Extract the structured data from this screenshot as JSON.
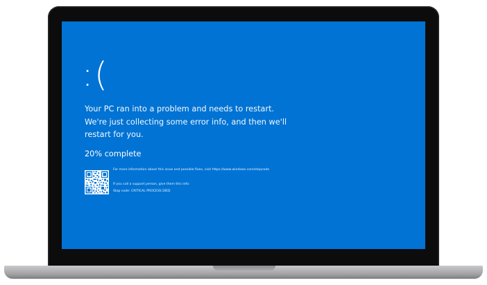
{
  "bsod": {
    "sad_face": ":(",
    "message": "Your PC ran into a problem and needs to restart. We're just collecting some error info, and then we'll restart for you.",
    "progress_text": "20% complete",
    "more_info": "For more information about this issue and possible fixes, visit https://www.windows.com/stopcode",
    "support_info": "If you call a support person, give them this info:",
    "stop_code": "Stop code: CRITICAL PROCESS DIED"
  },
  "colors": {
    "screen_background": "#0173d4",
    "text": "#ffffff",
    "laptop_bezel": "#0c0c0d",
    "laptop_base": "#a2a2a5"
  },
  "icons": {
    "qr_code": "qr-code-icon"
  }
}
